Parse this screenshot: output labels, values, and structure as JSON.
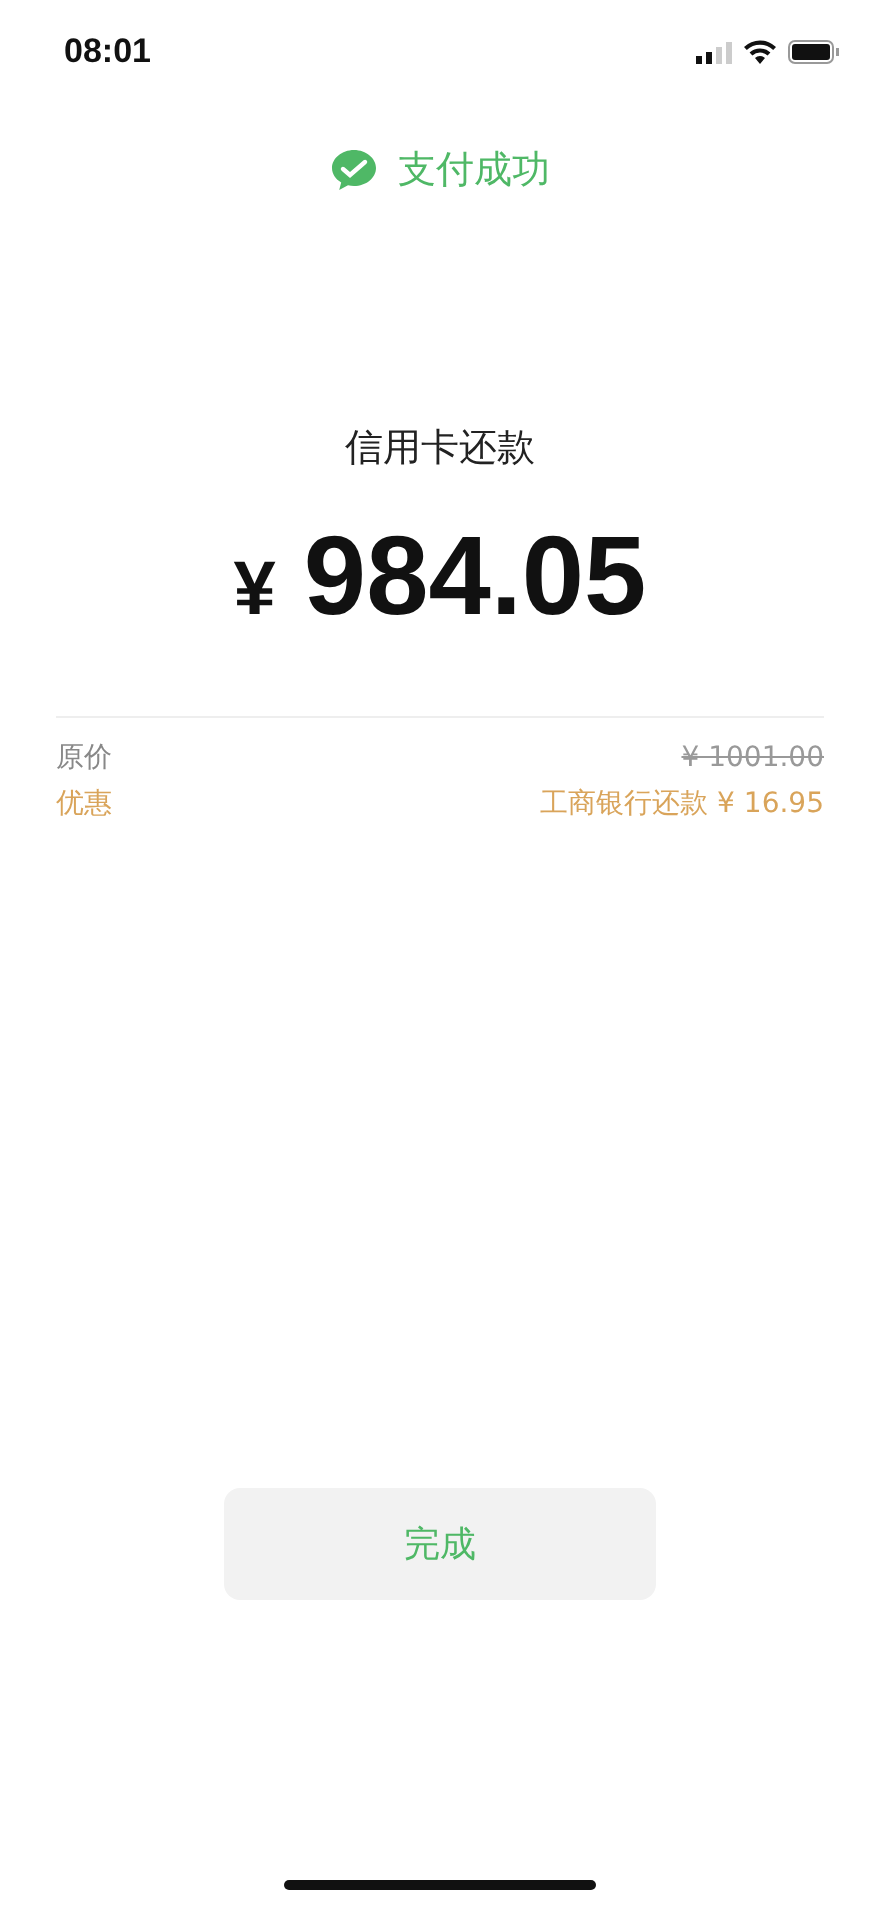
{
  "status_bar": {
    "time": "08:01"
  },
  "header": {
    "title": "支付成功"
  },
  "payment": {
    "label": "信用卡还款",
    "currency": "¥",
    "amount": "984.05"
  },
  "details": [
    {
      "kind": "original",
      "label": "原价",
      "value": "¥ 1001.00"
    },
    {
      "kind": "discount",
      "label": "优惠",
      "value": "工商银行还款 ¥ 16.95"
    }
  ],
  "button": {
    "label": "完成"
  }
}
